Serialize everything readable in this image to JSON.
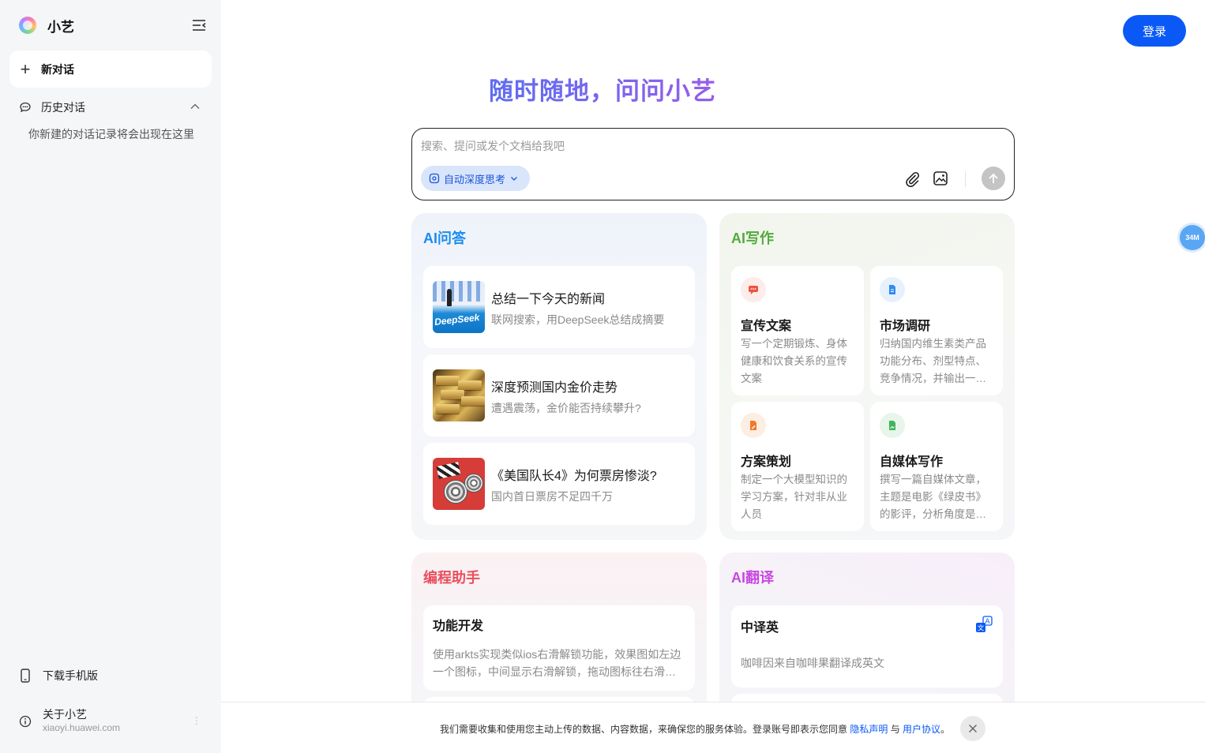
{
  "sidebar": {
    "brand_name": "小艺",
    "new_chat_label": "新对话",
    "history_label": "历史对话",
    "history_empty": "你新建的对话记录将会出现在这里",
    "download_label": "下载手机版",
    "about_label": "关于小艺",
    "about_url": "xiaoyi.huawei.com",
    "more_icon": "⋮"
  },
  "header": {
    "login_label": "登录"
  },
  "hero": {
    "title": "随时随地，问问小艺"
  },
  "composer": {
    "placeholder": "搜索、提问或发个文档给我吧",
    "deep_think_label": "自动深度思考"
  },
  "qa": {
    "title": "AI问答",
    "items": [
      {
        "title": "总结一下今天的新闻",
        "sub": "联网搜索，用DeepSeek总结成摘要",
        "thumb_text": "DeepSeek"
      },
      {
        "title": "深度预测国内金价走势",
        "sub": "遭遇震荡，金价能否持续攀升?"
      },
      {
        "title": "《美国队长4》为何票房惨淡?",
        "sub": "国内首日票房不足四千万"
      }
    ]
  },
  "writing": {
    "title": "AI写作",
    "items": [
      {
        "title": "宣传文案",
        "desc": "写一个定期锻炼、身体健康和饮食关系的宣传文案",
        "icon": "chat-bubble-icon",
        "color": "#f0533f"
      },
      {
        "title": "市场调研",
        "desc": "归纳国内维生素类产品功能分布、剂型特点、竞争情况，并输出一份报告",
        "icon": "document-icon",
        "color": "#2f8cf0"
      },
      {
        "title": "方案策划",
        "desc": "制定一个大模型知识的学习方案，针对非从业人员",
        "icon": "edit-doc-icon",
        "color": "#f07a2a"
      },
      {
        "title": "自媒体写作",
        "desc": "撰写一篇自媒体文章，主题是电影《绿皮书》的影评，分析角度是人物塑造",
        "icon": "image-doc-icon",
        "color": "#3fb55a"
      }
    ]
  },
  "coding": {
    "title": "编程助手",
    "item_title": "功能开发",
    "item_desc": "使用arkts实现类似ios右滑解锁功能，效果图如左边一个图标，中间显示右滑解锁，拖动图标往右滑动解锁"
  },
  "translate": {
    "title": "AI翻译",
    "item_title": "中译英",
    "item_desc": "咖啡因来自咖啡果翻译成英文",
    "icon_glyph": "文"
  },
  "float_badge": "34M",
  "consent": {
    "text_before": "我们需要收集和使用您主动上传的数据、内容数据，来确保您的服务体验。登录账号即表示您同意 ",
    "privacy_link": "隐私声明",
    "and": " 与 ",
    "terms_link": "用户协议",
    "text_end": "。"
  },
  "colors": {
    "accent": "#0a59f7",
    "qa_title": "#1a8cf0",
    "write_title": "#52ab3e",
    "code_title": "#ea4e5e",
    "trans_title": "#c848e0"
  }
}
